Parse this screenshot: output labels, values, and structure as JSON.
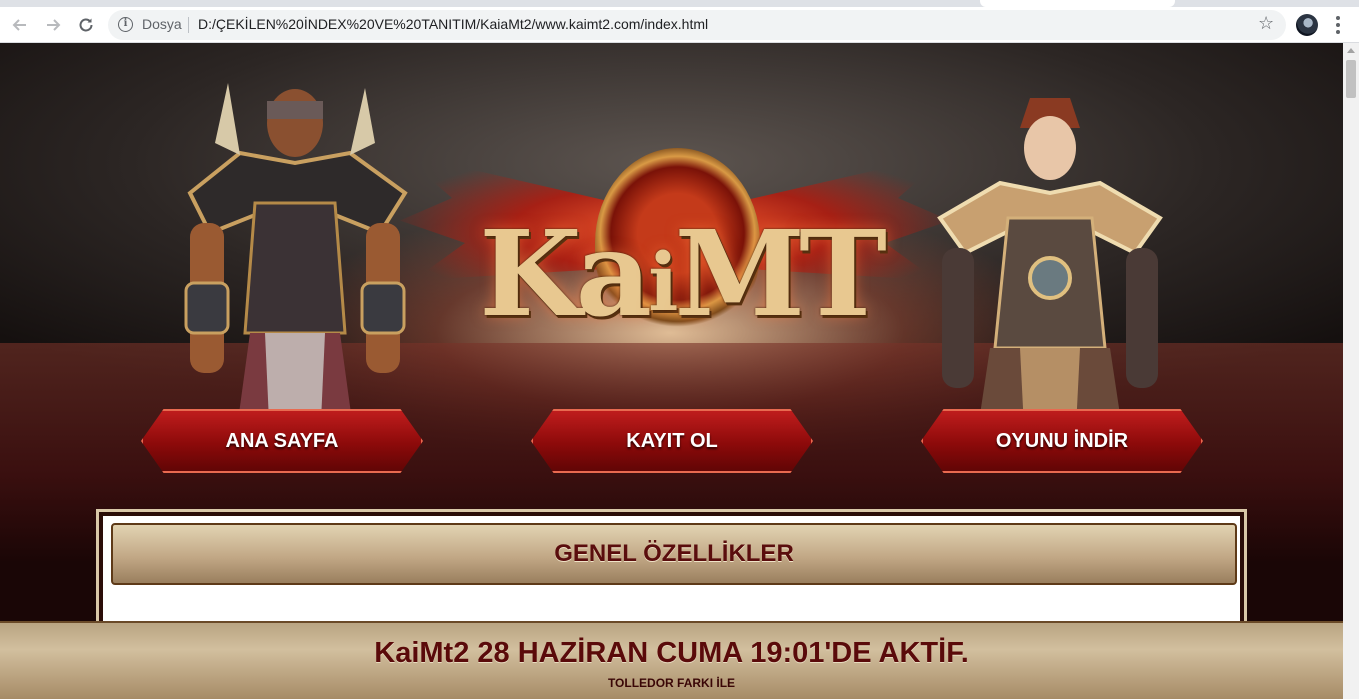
{
  "browser": {
    "origin_label": "Dosya",
    "url": "D:/ÇEKİLEN%20İNDEX%20VE%20TANITIM/KaiaMt2/www.kaimt2.com/index.html"
  },
  "hero": {
    "logo_text_start": "Ka",
    "logo_text_mid": "i",
    "logo_text_end": "MT"
  },
  "nav": {
    "items": [
      {
        "label": "ANA SAYFA"
      },
      {
        "label": "KAYIT OL"
      },
      {
        "label": "OYUNU İNDİR"
      }
    ]
  },
  "features": {
    "title": "GENEL ÖZELLİKLER"
  },
  "banner": {
    "title": "KaiMt2 28 HAZİRAN CUMA 19:01'DE AKTİF.",
    "subtitle": "TOLLEDOR FARKI İLE"
  },
  "colors": {
    "nav_red": "#8c0a0a",
    "banner_text": "#5a0a0a",
    "gold": "#c2a886"
  }
}
